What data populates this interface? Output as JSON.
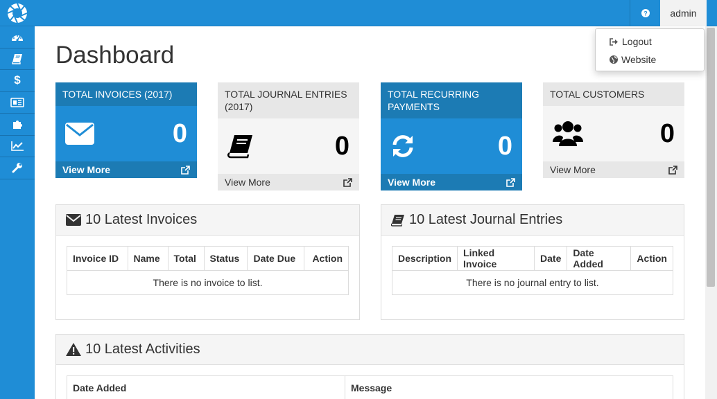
{
  "topbar": {
    "user_label": "admin",
    "help_icon": "question-circle-icon"
  },
  "user_menu": {
    "items": [
      {
        "label": "Logout",
        "icon": "sign-out-icon"
      },
      {
        "label": "Website",
        "icon": "globe-icon"
      }
    ]
  },
  "sidebar": {
    "items": [
      {
        "icon": "dashboard-icon"
      },
      {
        "icon": "book-icon"
      },
      {
        "icon": "dollar-icon"
      },
      {
        "icon": "newspaper-icon"
      },
      {
        "icon": "puzzle-icon"
      },
      {
        "icon": "line-chart-icon"
      },
      {
        "icon": "wrench-icon"
      }
    ]
  },
  "page": {
    "title": "Dashboard"
  },
  "cards": [
    {
      "title": "TOTAL INVOICES (2017)",
      "value": "0",
      "link": "View More",
      "icon": "envelope-icon"
    },
    {
      "title": "TOTAL JOURNAL ENTRIES (2017)",
      "value": "0",
      "link": "View More",
      "icon": "book-icon"
    },
    {
      "title": "TOTAL RECURRING PAYMENTS",
      "value": "0",
      "link": "View More",
      "icon": "refresh-icon"
    },
    {
      "title": "TOTAL CUSTOMERS",
      "value": "0",
      "link": "View More",
      "icon": "users-icon"
    }
  ],
  "invoices_panel": {
    "title": "10 Latest Invoices",
    "columns": [
      "Invoice ID",
      "Name",
      "Total",
      "Status",
      "Date Due",
      "Action"
    ],
    "empty": "There is no invoice to list."
  },
  "journal_panel": {
    "title": "10 Latest Journal Entries",
    "columns": [
      "Description",
      "Linked Invoice",
      "Date",
      "Date Added",
      "Action"
    ],
    "empty": "There is no journal entry to list."
  },
  "activities_panel": {
    "title": "10 Latest Activities",
    "columns": [
      "Date Added",
      "Message"
    ]
  },
  "colors": {
    "primary": "#1f8dd6",
    "primary_dark": "#1c7bb4",
    "card_grey": "#e7e7e7"
  }
}
